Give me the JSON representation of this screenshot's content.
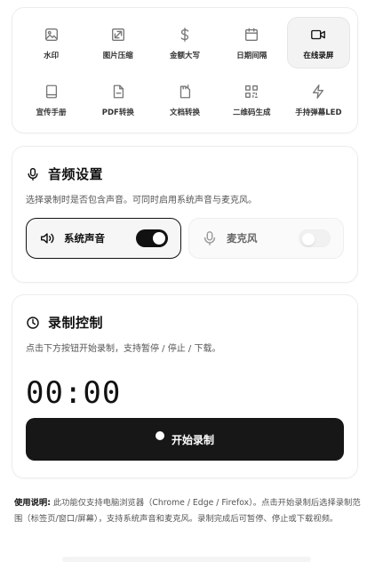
{
  "tools": [
    {
      "label": "水印",
      "icon": "image-icon",
      "active": false
    },
    {
      "label": "图片压缩",
      "icon": "compress-icon",
      "active": false
    },
    {
      "label": "金额大写",
      "icon": "dollar-icon",
      "active": false
    },
    {
      "label": "日期间隔",
      "icon": "calendar-icon",
      "active": false
    },
    {
      "label": "在线录屏",
      "icon": "video-icon",
      "active": true
    },
    {
      "label": "宣传手册",
      "icon": "booklet-icon",
      "active": false
    },
    {
      "label": "PDF转换",
      "icon": "pdf-file-icon",
      "active": false
    },
    {
      "label": "文档转换",
      "icon": "document-icon",
      "active": false
    },
    {
      "label": "二维码生成",
      "icon": "qrcode-icon",
      "active": false
    },
    {
      "label": "手持弹幕LED",
      "icon": "lightning-icon",
      "active": false
    }
  ],
  "audio": {
    "title": "音频设置",
    "icon": "microphone-icon",
    "description": "选择录制时是否包含声音。可同时启用系统声音与麦克风。",
    "system_sound": {
      "label": "系统声音",
      "icon": "speaker-icon",
      "enabled": true
    },
    "microphone": {
      "label": "麦克风",
      "icon": "microphone-icon",
      "enabled": false
    }
  },
  "recording": {
    "title": "录制控制",
    "icon": "clock-icon",
    "description": "点击下方按钮开始录制，支持暂停 / 停止 / 下载。",
    "timer": "00:00",
    "start_label": "开始录制"
  },
  "note": {
    "bold": "使用说明:",
    "text": " 此功能仅支持电脑浏览器（Chrome / Edge / Firefox）。点击开始录制后选择录制范围（标签页/窗口/屏幕），支持系统声音和麦克风。录制完成后可暂停、停止或下载视频。"
  },
  "colors": {
    "accent": "#111111",
    "border": "#ececec",
    "muted": "#555555"
  }
}
